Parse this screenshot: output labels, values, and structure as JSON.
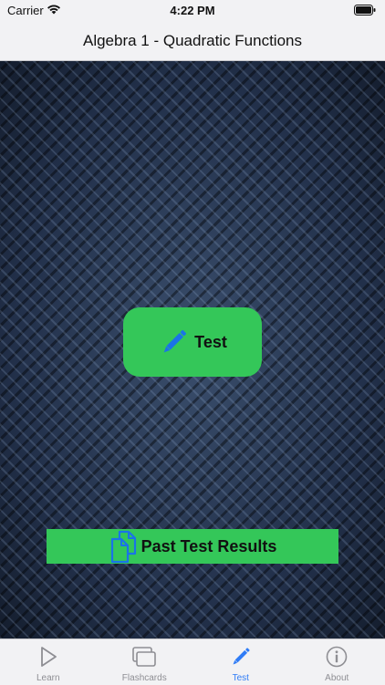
{
  "status_bar": {
    "carrier": "Carrier",
    "time": "4:22 PM"
  },
  "nav": {
    "title": "Algebra 1 - Quadratic Functions"
  },
  "main": {
    "test_button_label": "Test",
    "results_button_label": "Past Test Results"
  },
  "tabs": [
    {
      "label": "Learn",
      "icon": "play-icon",
      "active": false
    },
    {
      "label": "Flashcards",
      "icon": "cards-icon",
      "active": false
    },
    {
      "label": "Test",
      "icon": "pencil-icon",
      "active": true
    },
    {
      "label": "About",
      "icon": "info-icon",
      "active": false
    }
  ],
  "colors": {
    "accent_green": "#34c759",
    "tab_active": "#2f7cf6",
    "tab_inactive": "#8e8e93",
    "icon_blue": "#1a73e8"
  }
}
